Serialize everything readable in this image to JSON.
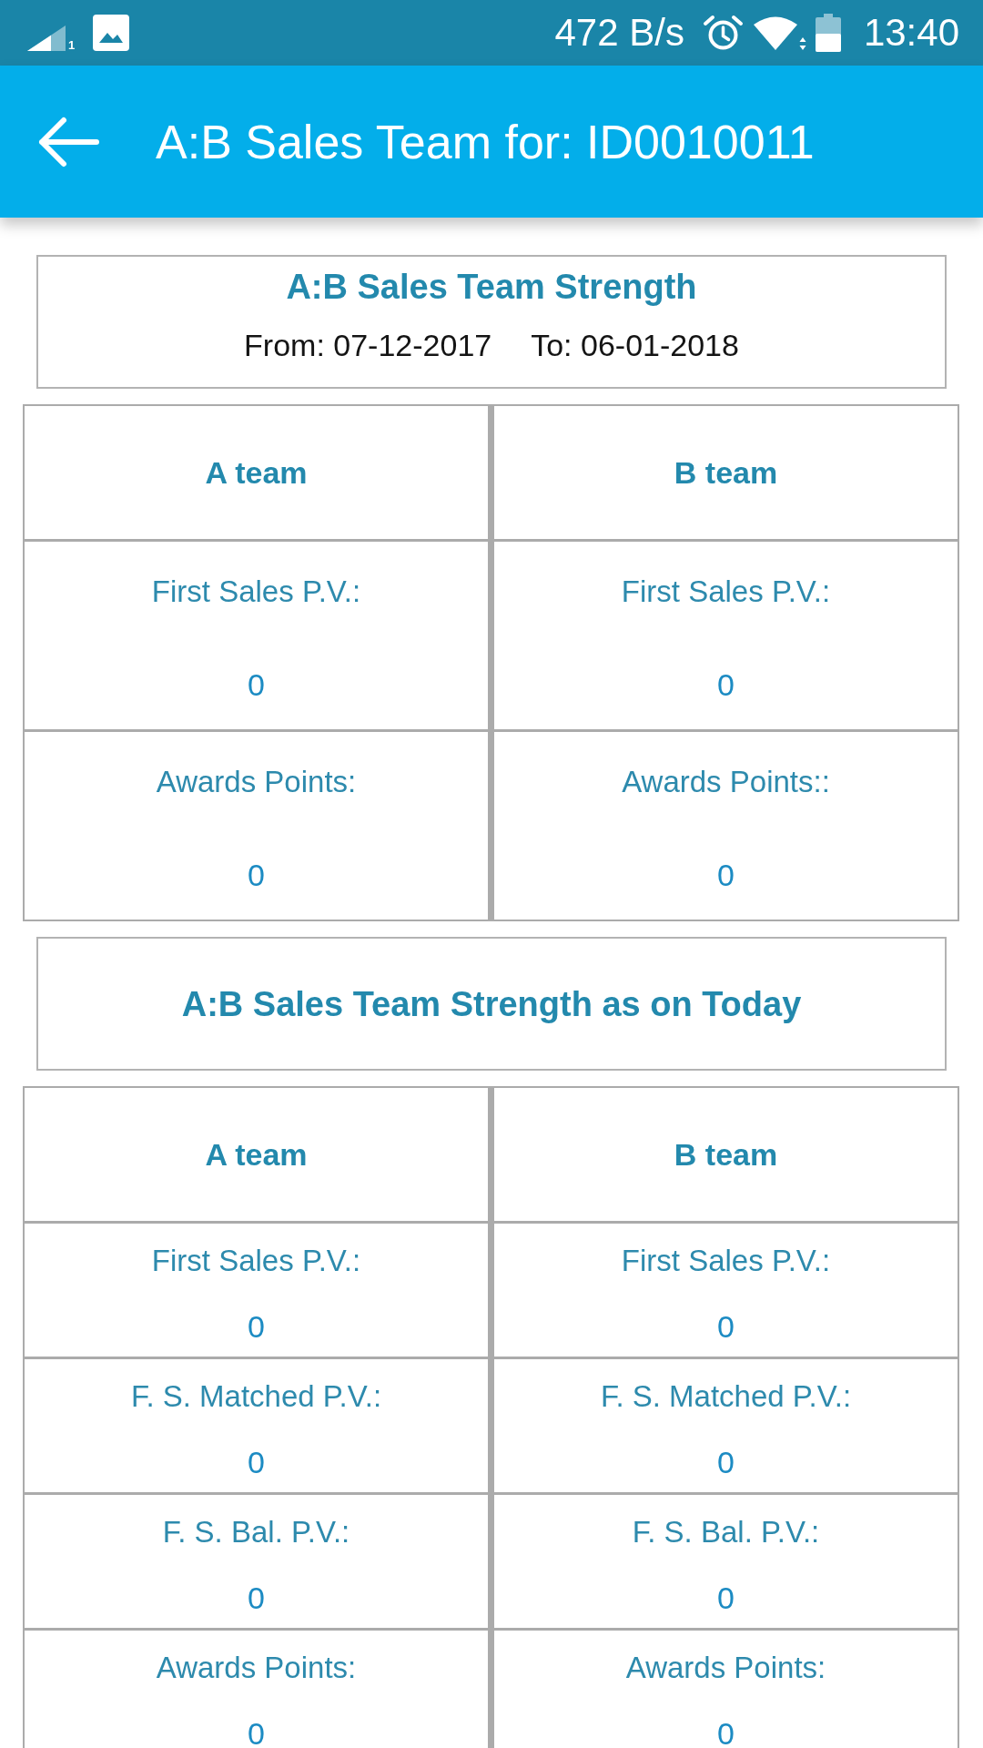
{
  "status_bar": {
    "sim_slot": "1",
    "net_speed": "472 B/s",
    "time": "13:40"
  },
  "app_bar": {
    "title": "A:B Sales Team for: ID0010011"
  },
  "sections": [
    {
      "title": "A:B Sales Team Strength",
      "date_from": "From: 07-12-2017",
      "date_to": "To: 06-01-2018",
      "table": {
        "columns": [
          "A team",
          "B team"
        ],
        "rows": [
          [
            {
              "label": "First Sales P.V.:",
              "value": "0"
            },
            {
              "label": "First Sales P.V.:",
              "value": "0"
            }
          ],
          [
            {
              "label": "Awards Points:",
              "value": "0"
            },
            {
              "label": "Awards Points::",
              "value": "0"
            }
          ]
        ]
      }
    },
    {
      "title": "A:B Sales Team Strength as on Today",
      "table": {
        "columns": [
          "A team",
          "B team"
        ],
        "rows": [
          [
            {
              "label": "First Sales P.V.:",
              "value": "0"
            },
            {
              "label": "First Sales P.V.:",
              "value": "0"
            }
          ],
          [
            {
              "label": "F. S. Matched P.V.:",
              "value": "0"
            },
            {
              "label": "F. S. Matched P.V.:",
              "value": "0"
            }
          ],
          [
            {
              "label": "F. S. Bal. P.V.:",
              "value": "0"
            },
            {
              "label": "F. S. Bal. P.V.:",
              "value": "0"
            }
          ],
          [
            {
              "label": "Awards Points:",
              "value": "0"
            },
            {
              "label": "Awards Points:",
              "value": "0"
            }
          ]
        ]
      }
    }
  ]
}
